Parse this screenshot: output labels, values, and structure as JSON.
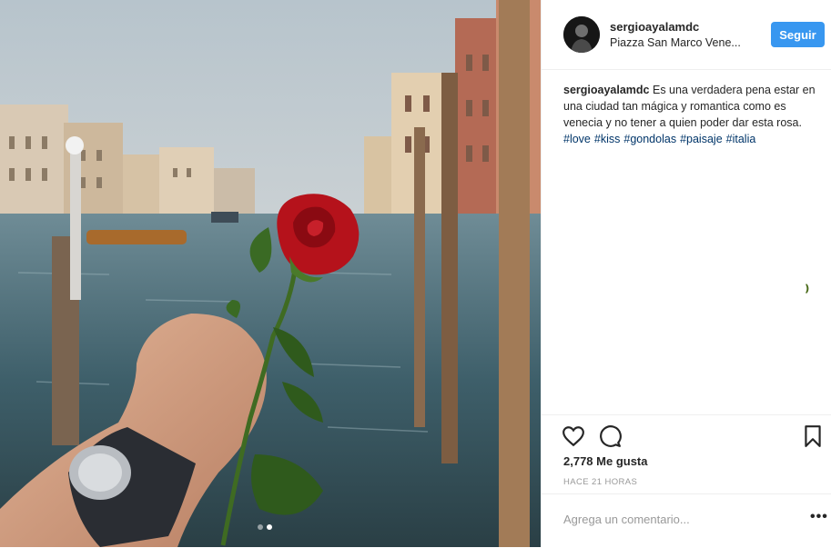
{
  "post": {
    "username": "sergioayalamdc",
    "location": "Piazza San Marco Vene...",
    "follow_label": "Seguir",
    "caption_user": "sergioayalamdc",
    "caption_text": "Es una verdadera pena estar en una ciudad tan mágica y romantica como es venecia y no tener a quien poder dar esta rosa.",
    "hashtags": [
      "#love",
      "#kiss",
      "#gondolas",
      "#paisaje",
      "#italia"
    ],
    "likes": "2,778 Me gusta",
    "time_ago": "HACE 21 HORAS",
    "comment_placeholder": "Agrega un comentario...",
    "more_label": "•••",
    "carousel": {
      "count": 2,
      "active": 2
    }
  },
  "icons": {
    "like": "heart-icon",
    "comment": "comment-icon",
    "save": "bookmark-icon",
    "more": "more-options-icon"
  },
  "colors": {
    "follow_button": "#3897f0",
    "hashtag": "#003569",
    "text": "#262626",
    "muted": "#999999"
  }
}
